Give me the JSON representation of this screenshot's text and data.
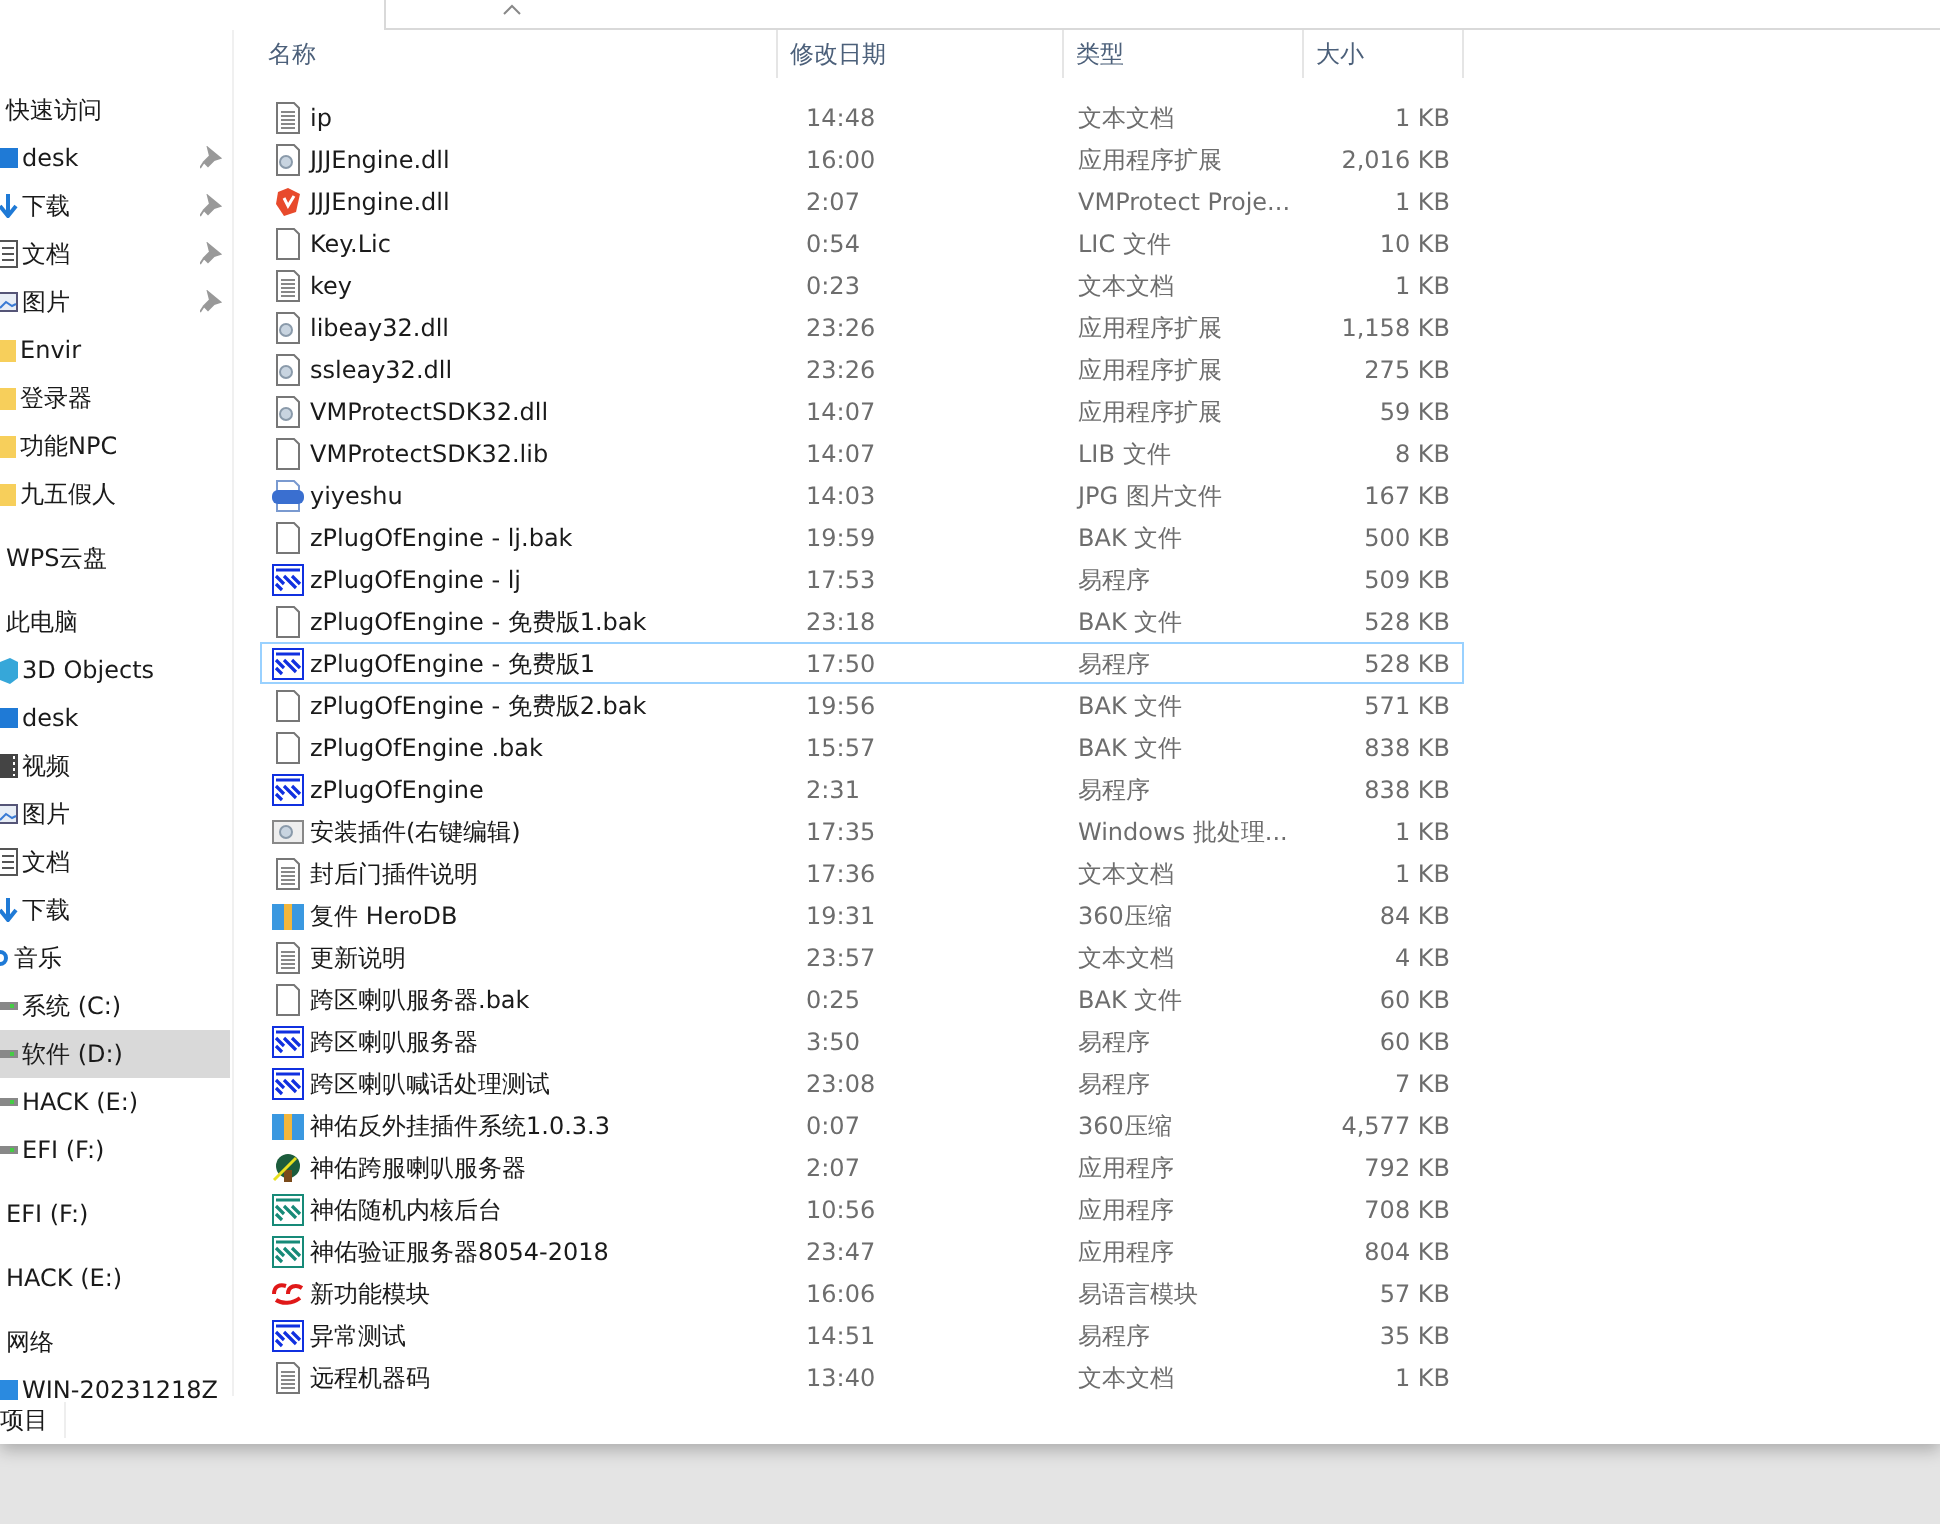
{
  "sidebar": {
    "items": [
      {
        "kind": "header",
        "label": "快速访问",
        "pinned": false,
        "selected": false
      },
      {
        "kind": "monitor",
        "label": "desk",
        "pinned": true,
        "selected": false
      },
      {
        "kind": "download",
        "label": "下载",
        "pinned": true,
        "selected": false
      },
      {
        "kind": "doc",
        "label": "文档",
        "pinned": true,
        "selected": false
      },
      {
        "kind": "picture",
        "label": "图片",
        "pinned": true,
        "selected": false
      },
      {
        "kind": "folder",
        "label": "Envir",
        "pinned": false,
        "selected": false
      },
      {
        "kind": "folder",
        "label": "登录器",
        "pinned": false,
        "selected": false
      },
      {
        "kind": "folder",
        "label": "功能NPC",
        "pinned": false,
        "selected": false
      },
      {
        "kind": "folder",
        "label": "九五假人",
        "pinned": false,
        "selected": false
      },
      {
        "kind": "header",
        "label": "WPS云盘",
        "pinned": false,
        "selected": false
      },
      {
        "kind": "header",
        "label": "此电脑",
        "pinned": false,
        "selected": false
      },
      {
        "kind": "cube",
        "label": "3D Objects",
        "pinned": false,
        "selected": false
      },
      {
        "kind": "monitor",
        "label": "desk",
        "pinned": false,
        "selected": false
      },
      {
        "kind": "video",
        "label": "视频",
        "pinned": false,
        "selected": false
      },
      {
        "kind": "picture",
        "label": "图片",
        "pinned": false,
        "selected": false
      },
      {
        "kind": "doc",
        "label": "文档",
        "pinned": false,
        "selected": false
      },
      {
        "kind": "download",
        "label": "下载",
        "pinned": false,
        "selected": false
      },
      {
        "kind": "music",
        "label": "音乐",
        "pinned": false,
        "selected": false
      },
      {
        "kind": "drive",
        "label": "系统 (C:)",
        "pinned": false,
        "selected": false
      },
      {
        "kind": "drive",
        "label": "软件 (D:)",
        "pinned": false,
        "selected": true
      },
      {
        "kind": "drive",
        "label": "HACK (E:)",
        "pinned": false,
        "selected": false
      },
      {
        "kind": "drive",
        "label": "EFI (F:)",
        "pinned": false,
        "selected": false
      },
      {
        "kind": "header",
        "label": "EFI (F:)",
        "pinned": false,
        "selected": false
      },
      {
        "kind": "header",
        "label": "HACK (E:)",
        "pinned": false,
        "selected": false
      },
      {
        "kind": "header",
        "label": "网络",
        "pinned": false,
        "selected": false
      },
      {
        "kind": "computer",
        "label": "WIN-20231218Z",
        "pinned": false,
        "selected": false
      }
    ]
  },
  "table": {
    "columns": [
      "名称",
      "修改日期",
      "类型",
      "大小"
    ],
    "rows": [
      {
        "kind": "text",
        "name": "ip",
        "date": "14:48",
        "type": "文本文档",
        "size": "1 KB",
        "focused": false
      },
      {
        "kind": "dll",
        "name": "JJJEngine.dll",
        "date": "16:00",
        "type": "应用程序扩展",
        "size": "2,016 KB",
        "focused": false
      },
      {
        "kind": "vmp",
        "name": "JJJEngine.dll",
        "date": "2:07",
        "type": "VMProtect Proje...",
        "size": "1 KB",
        "focused": false
      },
      {
        "kind": "blank",
        "name": "Key.Lic",
        "date": "0:54",
        "type": "LIC 文件",
        "size": "10 KB",
        "focused": false
      },
      {
        "kind": "text",
        "name": "key",
        "date": "0:23",
        "type": "文本文档",
        "size": "1 KB",
        "focused": false
      },
      {
        "kind": "dll",
        "name": "libeay32.dll",
        "date": "23:26",
        "type": "应用程序扩展",
        "size": "1,158 KB",
        "focused": false
      },
      {
        "kind": "dll",
        "name": "ssleay32.dll",
        "date": "23:26",
        "type": "应用程序扩展",
        "size": "275 KB",
        "focused": false
      },
      {
        "kind": "dll",
        "name": "VMProtectSDK32.dll",
        "date": "14:07",
        "type": "应用程序扩展",
        "size": "59 KB",
        "focused": false
      },
      {
        "kind": "blank",
        "name": "VMProtectSDK32.lib",
        "date": "14:07",
        "type": "LIB 文件",
        "size": "8 KB",
        "focused": false
      },
      {
        "kind": "jpg",
        "name": "yiyeshu",
        "date": "14:03",
        "type": "JPG 图片文件",
        "size": "167 KB",
        "focused": false
      },
      {
        "kind": "blank",
        "name": "zPlugOfEngine - lj.bak",
        "date": "19:59",
        "type": "BAK 文件",
        "size": "500 KB",
        "focused": false
      },
      {
        "kind": "e",
        "name": "zPlugOfEngine - lj",
        "date": "17:53",
        "type": "易程序",
        "size": "509 KB",
        "focused": false
      },
      {
        "kind": "blank",
        "name": "zPlugOfEngine - 免费版1.bak",
        "date": "23:18",
        "type": "BAK 文件",
        "size": "528 KB",
        "focused": false
      },
      {
        "kind": "e",
        "name": "zPlugOfEngine - 免费版1",
        "date": "17:50",
        "type": "易程序",
        "size": "528 KB",
        "focused": true
      },
      {
        "kind": "blank",
        "name": "zPlugOfEngine - 免费版2.bak",
        "date": "19:56",
        "type": "BAK 文件",
        "size": "571 KB",
        "focused": false
      },
      {
        "kind": "blank",
        "name": "zPlugOfEngine .bak",
        "date": "15:57",
        "type": "BAK 文件",
        "size": "838 KB",
        "focused": false
      },
      {
        "kind": "e",
        "name": "zPlugOfEngine",
        "date": "2:31",
        "type": "易程序",
        "size": "838 KB",
        "focused": false
      },
      {
        "kind": "bat",
        "name": "安装插件(右键编辑)",
        "date": "17:35",
        "type": "Windows 批处理...",
        "size": "1 KB",
        "focused": false
      },
      {
        "kind": "text",
        "name": "封后门插件说明",
        "date": "17:36",
        "type": "文本文档",
        "size": "1 KB",
        "focused": false
      },
      {
        "kind": "zip",
        "name": "复件 HeroDB",
        "date": "19:31",
        "type": "360压缩",
        "size": "84 KB",
        "focused": false
      },
      {
        "kind": "text",
        "name": "更新说明",
        "date": "23:57",
        "type": "文本文档",
        "size": "4 KB",
        "focused": false
      },
      {
        "kind": "blank",
        "name": "跨区喇叭服务器.bak",
        "date": "0:25",
        "type": "BAK 文件",
        "size": "60 KB",
        "focused": false
      },
      {
        "kind": "e",
        "name": "跨区喇叭服务器",
        "date": "3:50",
        "type": "易程序",
        "size": "60 KB",
        "focused": false
      },
      {
        "kind": "e",
        "name": "跨区喇叭喊话处理测试",
        "date": "23:08",
        "type": "易程序",
        "size": "7 KB",
        "focused": false
      },
      {
        "kind": "zip",
        "name": "神佑反外挂插件系统1.0.3.3",
        "date": "0:07",
        "type": "360压缩",
        "size": "4,577 KB",
        "focused": false
      },
      {
        "kind": "app",
        "name": "神佑跨服喇叭服务器",
        "date": "2:07",
        "type": "应用程序",
        "size": "792 KB",
        "focused": false
      },
      {
        "kind": "eteal",
        "name": "神佑随机内核后台",
        "date": "10:56",
        "type": "应用程序",
        "size": "708 KB",
        "focused": false
      },
      {
        "kind": "eteal",
        "name": "神佑验证服务器8054-2018",
        "date": "23:47",
        "type": "应用程序",
        "size": "804 KB",
        "focused": false
      },
      {
        "kind": "ec",
        "name": "新功能模块",
        "date": "16:06",
        "type": "易语言模块",
        "size": "57 KB",
        "focused": false
      },
      {
        "kind": "e",
        "name": "异常测试",
        "date": "14:51",
        "type": "易程序",
        "size": "35 KB",
        "focused": false
      },
      {
        "kind": "text",
        "name": "远程机器码",
        "date": "13:40",
        "type": "文本文档",
        "size": "1 KB",
        "focused": false
      }
    ]
  },
  "status_bar": {
    "text": "项目"
  }
}
